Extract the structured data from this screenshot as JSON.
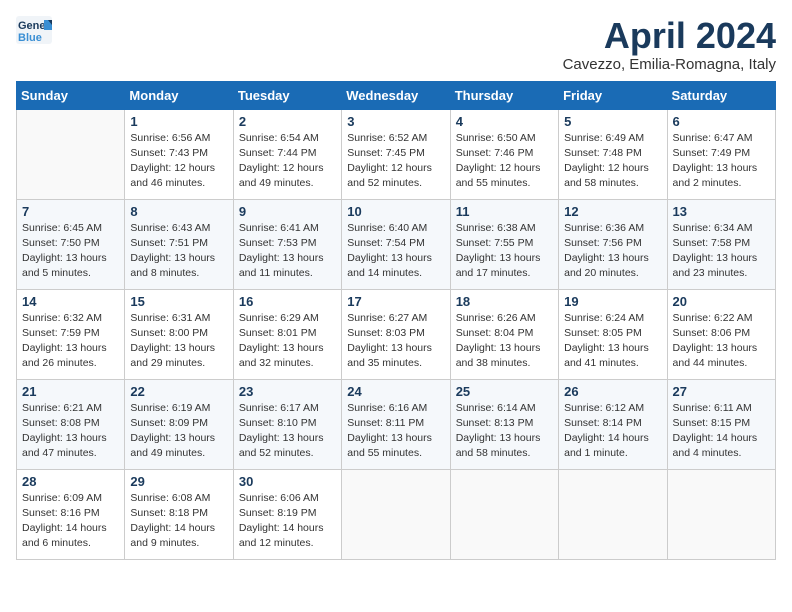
{
  "logo": {
    "line1": "General",
    "line2": "Blue"
  },
  "title": "April 2024",
  "location": "Cavezzo, Emilia-Romagna, Italy",
  "days_header": [
    "Sunday",
    "Monday",
    "Tuesday",
    "Wednesday",
    "Thursday",
    "Friday",
    "Saturday"
  ],
  "weeks": [
    [
      {
        "num": "",
        "sunrise": "",
        "sunset": "",
        "daylight": ""
      },
      {
        "num": "1",
        "sunrise": "Sunrise: 6:56 AM",
        "sunset": "Sunset: 7:43 PM",
        "daylight": "Daylight: 12 hours and 46 minutes."
      },
      {
        "num": "2",
        "sunrise": "Sunrise: 6:54 AM",
        "sunset": "Sunset: 7:44 PM",
        "daylight": "Daylight: 12 hours and 49 minutes."
      },
      {
        "num": "3",
        "sunrise": "Sunrise: 6:52 AM",
        "sunset": "Sunset: 7:45 PM",
        "daylight": "Daylight: 12 hours and 52 minutes."
      },
      {
        "num": "4",
        "sunrise": "Sunrise: 6:50 AM",
        "sunset": "Sunset: 7:46 PM",
        "daylight": "Daylight: 12 hours and 55 minutes."
      },
      {
        "num": "5",
        "sunrise": "Sunrise: 6:49 AM",
        "sunset": "Sunset: 7:48 PM",
        "daylight": "Daylight: 12 hours and 58 minutes."
      },
      {
        "num": "6",
        "sunrise": "Sunrise: 6:47 AM",
        "sunset": "Sunset: 7:49 PM",
        "daylight": "Daylight: 13 hours and 2 minutes."
      }
    ],
    [
      {
        "num": "7",
        "sunrise": "Sunrise: 6:45 AM",
        "sunset": "Sunset: 7:50 PM",
        "daylight": "Daylight: 13 hours and 5 minutes."
      },
      {
        "num": "8",
        "sunrise": "Sunrise: 6:43 AM",
        "sunset": "Sunset: 7:51 PM",
        "daylight": "Daylight: 13 hours and 8 minutes."
      },
      {
        "num": "9",
        "sunrise": "Sunrise: 6:41 AM",
        "sunset": "Sunset: 7:53 PM",
        "daylight": "Daylight: 13 hours and 11 minutes."
      },
      {
        "num": "10",
        "sunrise": "Sunrise: 6:40 AM",
        "sunset": "Sunset: 7:54 PM",
        "daylight": "Daylight: 13 hours and 14 minutes."
      },
      {
        "num": "11",
        "sunrise": "Sunrise: 6:38 AM",
        "sunset": "Sunset: 7:55 PM",
        "daylight": "Daylight: 13 hours and 17 minutes."
      },
      {
        "num": "12",
        "sunrise": "Sunrise: 6:36 AM",
        "sunset": "Sunset: 7:56 PM",
        "daylight": "Daylight: 13 hours and 20 minutes."
      },
      {
        "num": "13",
        "sunrise": "Sunrise: 6:34 AM",
        "sunset": "Sunset: 7:58 PM",
        "daylight": "Daylight: 13 hours and 23 minutes."
      }
    ],
    [
      {
        "num": "14",
        "sunrise": "Sunrise: 6:32 AM",
        "sunset": "Sunset: 7:59 PM",
        "daylight": "Daylight: 13 hours and 26 minutes."
      },
      {
        "num": "15",
        "sunrise": "Sunrise: 6:31 AM",
        "sunset": "Sunset: 8:00 PM",
        "daylight": "Daylight: 13 hours and 29 minutes."
      },
      {
        "num": "16",
        "sunrise": "Sunrise: 6:29 AM",
        "sunset": "Sunset: 8:01 PM",
        "daylight": "Daylight: 13 hours and 32 minutes."
      },
      {
        "num": "17",
        "sunrise": "Sunrise: 6:27 AM",
        "sunset": "Sunset: 8:03 PM",
        "daylight": "Daylight: 13 hours and 35 minutes."
      },
      {
        "num": "18",
        "sunrise": "Sunrise: 6:26 AM",
        "sunset": "Sunset: 8:04 PM",
        "daylight": "Daylight: 13 hours and 38 minutes."
      },
      {
        "num": "19",
        "sunrise": "Sunrise: 6:24 AM",
        "sunset": "Sunset: 8:05 PM",
        "daylight": "Daylight: 13 hours and 41 minutes."
      },
      {
        "num": "20",
        "sunrise": "Sunrise: 6:22 AM",
        "sunset": "Sunset: 8:06 PM",
        "daylight": "Daylight: 13 hours and 44 minutes."
      }
    ],
    [
      {
        "num": "21",
        "sunrise": "Sunrise: 6:21 AM",
        "sunset": "Sunset: 8:08 PM",
        "daylight": "Daylight: 13 hours and 47 minutes."
      },
      {
        "num": "22",
        "sunrise": "Sunrise: 6:19 AM",
        "sunset": "Sunset: 8:09 PM",
        "daylight": "Daylight: 13 hours and 49 minutes."
      },
      {
        "num": "23",
        "sunrise": "Sunrise: 6:17 AM",
        "sunset": "Sunset: 8:10 PM",
        "daylight": "Daylight: 13 hours and 52 minutes."
      },
      {
        "num": "24",
        "sunrise": "Sunrise: 6:16 AM",
        "sunset": "Sunset: 8:11 PM",
        "daylight": "Daylight: 13 hours and 55 minutes."
      },
      {
        "num": "25",
        "sunrise": "Sunrise: 6:14 AM",
        "sunset": "Sunset: 8:13 PM",
        "daylight": "Daylight: 13 hours and 58 minutes."
      },
      {
        "num": "26",
        "sunrise": "Sunrise: 6:12 AM",
        "sunset": "Sunset: 8:14 PM",
        "daylight": "Daylight: 14 hours and 1 minute."
      },
      {
        "num": "27",
        "sunrise": "Sunrise: 6:11 AM",
        "sunset": "Sunset: 8:15 PM",
        "daylight": "Daylight: 14 hours and 4 minutes."
      }
    ],
    [
      {
        "num": "28",
        "sunrise": "Sunrise: 6:09 AM",
        "sunset": "Sunset: 8:16 PM",
        "daylight": "Daylight: 14 hours and 6 minutes."
      },
      {
        "num": "29",
        "sunrise": "Sunrise: 6:08 AM",
        "sunset": "Sunset: 8:18 PM",
        "daylight": "Daylight: 14 hours and 9 minutes."
      },
      {
        "num": "30",
        "sunrise": "Sunrise: 6:06 AM",
        "sunset": "Sunset: 8:19 PM",
        "daylight": "Daylight: 14 hours and 12 minutes."
      },
      {
        "num": "",
        "sunrise": "",
        "sunset": "",
        "daylight": ""
      },
      {
        "num": "",
        "sunrise": "",
        "sunset": "",
        "daylight": ""
      },
      {
        "num": "",
        "sunrise": "",
        "sunset": "",
        "daylight": ""
      },
      {
        "num": "",
        "sunrise": "",
        "sunset": "",
        "daylight": ""
      }
    ]
  ]
}
